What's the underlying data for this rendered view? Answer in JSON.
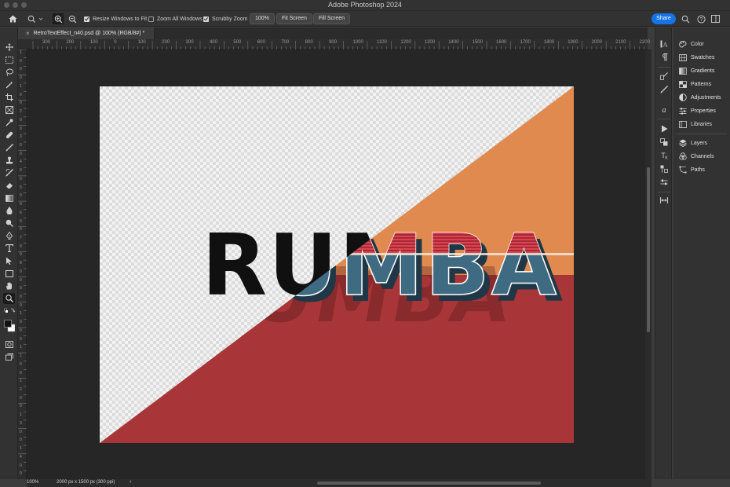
{
  "window": {
    "title": "Adobe Photoshop 2024"
  },
  "options_bar": {
    "resize_windows_label": "Resize Windows to Fit",
    "resize_windows_checked": true,
    "zoom_all_label": "Zoom All Windows",
    "zoom_all_checked": false,
    "scrubby_zoom_label": "Scrubby Zoom",
    "scrubby_zoom_checked": true,
    "zoom_value": "100%",
    "fit_screen_label": "Fit Screen",
    "fill_screen_label": "Fill Screen",
    "share_label": "Share"
  },
  "document": {
    "tab_title": "RetroTextEffect_n40.psd @ 100% (RGB/8#) *",
    "close_glyph": "×"
  },
  "rulers": {
    "horizontal": [
      "300",
      "200",
      "100",
      "0",
      "100",
      "200",
      "300",
      "400",
      "500",
      "600",
      "700",
      "800",
      "900",
      "1000",
      "1100",
      "1200",
      "1300",
      "1400",
      "1500",
      "1600",
      "1700",
      "1800",
      "1900",
      "2000",
      "2100",
      "2200"
    ],
    "vertical": [
      "1",
      "0",
      "0",
      "0",
      "1",
      "0",
      "0",
      "2",
      "0",
      "0",
      "3",
      "0",
      "0",
      "4",
      "0",
      "0",
      "5",
      "0",
      "0",
      "6",
      "0",
      "0",
      "7",
      "0",
      "0",
      "8",
      "0",
      "0",
      "9",
      "0",
      "0",
      "1",
      "0",
      "0",
      "0",
      "1",
      "1",
      "0",
      "0",
      "1",
      "2",
      "0",
      "0",
      "1",
      "3",
      "0",
      "0",
      "1",
      "4",
      "0",
      "0"
    ]
  },
  "canvas": {
    "text": "RUMBA",
    "colors": {
      "orange": "#e08a4f",
      "red": "#a83638",
      "checker_light": "#f2f2f2",
      "checker_dark": "#dcdcdc",
      "text_black": "#101010",
      "text_blue": "#3f6b82",
      "text_red": "#c9373e"
    }
  },
  "status": {
    "zoom": "100%",
    "doc_size": "2000 px x 1500 px (300 ppi)",
    "arrow": "›"
  },
  "panels": [
    {
      "label": "Color",
      "icon": "color-palette-icon"
    },
    {
      "label": "Swatches",
      "icon": "swatches-grid-icon"
    },
    {
      "label": "Gradients",
      "icon": "gradient-icon"
    },
    {
      "label": "Patterns",
      "icon": "patterns-grid-icon"
    },
    {
      "label": "Adjustments",
      "icon": "adjustments-icon"
    },
    {
      "label": "Properties",
      "icon": "properties-sliders-icon"
    },
    {
      "label": "Libraries",
      "icon": "libraries-icon"
    },
    {
      "label": "Layers",
      "icon": "layers-stack-icon"
    },
    {
      "label": "Channels",
      "icon": "channels-icon"
    },
    {
      "label": "Paths",
      "icon": "paths-pen-icon"
    }
  ]
}
